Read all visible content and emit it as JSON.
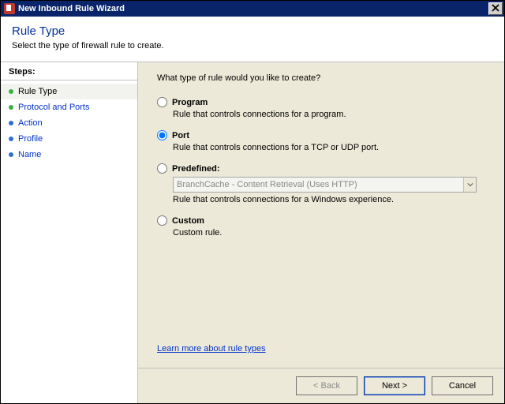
{
  "titlebar": {
    "title": "New Inbound Rule Wizard",
    "close": "X"
  },
  "header": {
    "title": "Rule Type",
    "subtitle": "Select the type of firewall rule to create."
  },
  "steps": {
    "title": "Steps:",
    "items": [
      {
        "label": "Rule Type"
      },
      {
        "label": "Protocol and Ports"
      },
      {
        "label": "Action"
      },
      {
        "label": "Profile"
      },
      {
        "label": "Name"
      }
    ],
    "current_index": 0
  },
  "main": {
    "prompt": "What type of rule would you like to create?",
    "options": {
      "program": {
        "label": "Program",
        "desc": "Rule that controls connections for a program.",
        "selected": false,
        "enabled": true
      },
      "port": {
        "label": "Port",
        "desc": "Rule that controls connections for a TCP or UDP port.",
        "selected": true,
        "enabled": true
      },
      "predefined": {
        "label": "Predefined:",
        "selected": false,
        "enabled": true,
        "dropdown_value": "BranchCache - Content Retrieval (Uses HTTP)",
        "desc": "Rule that controls connections for a Windows experience."
      },
      "custom": {
        "label": "Custom",
        "desc": "Custom rule.",
        "selected": false,
        "enabled": true
      }
    },
    "learn_more": "Learn more about rule types"
  },
  "footer": {
    "back": "< Back",
    "next": "Next >",
    "cancel": "Cancel"
  }
}
